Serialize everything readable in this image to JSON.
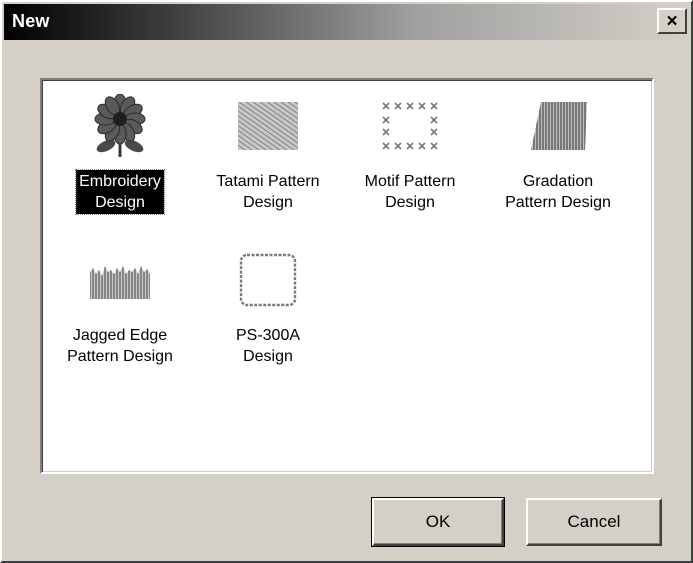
{
  "window": {
    "title": "New",
    "close_label": "×"
  },
  "templates": [
    {
      "id": "embroidery",
      "line1": "Embroidery",
      "line2": "Design",
      "selected": true
    },
    {
      "id": "tatami",
      "line1": "Tatami Pattern",
      "line2": "Design",
      "selected": false
    },
    {
      "id": "motif",
      "line1": "Motif Pattern",
      "line2": "Design",
      "selected": false
    },
    {
      "id": "gradation",
      "line1": "Gradation",
      "line2": "Pattern Design",
      "selected": false
    },
    {
      "id": "jagged",
      "line1": "Jagged Edge",
      "line2": "Pattern Design",
      "selected": false
    },
    {
      "id": "ps300a",
      "line1": "PS-300A",
      "line2": "Design",
      "selected": false
    }
  ],
  "buttons": {
    "ok_label": "OK",
    "cancel_label": "Cancel"
  },
  "icons": {
    "embroidery": "flower-icon",
    "tatami": "tatami-pattern-icon",
    "motif": "motif-pattern-icon",
    "gradation": "gradation-pattern-icon",
    "jagged": "jagged-edge-icon",
    "ps300a": "ps300a-frame-icon"
  }
}
